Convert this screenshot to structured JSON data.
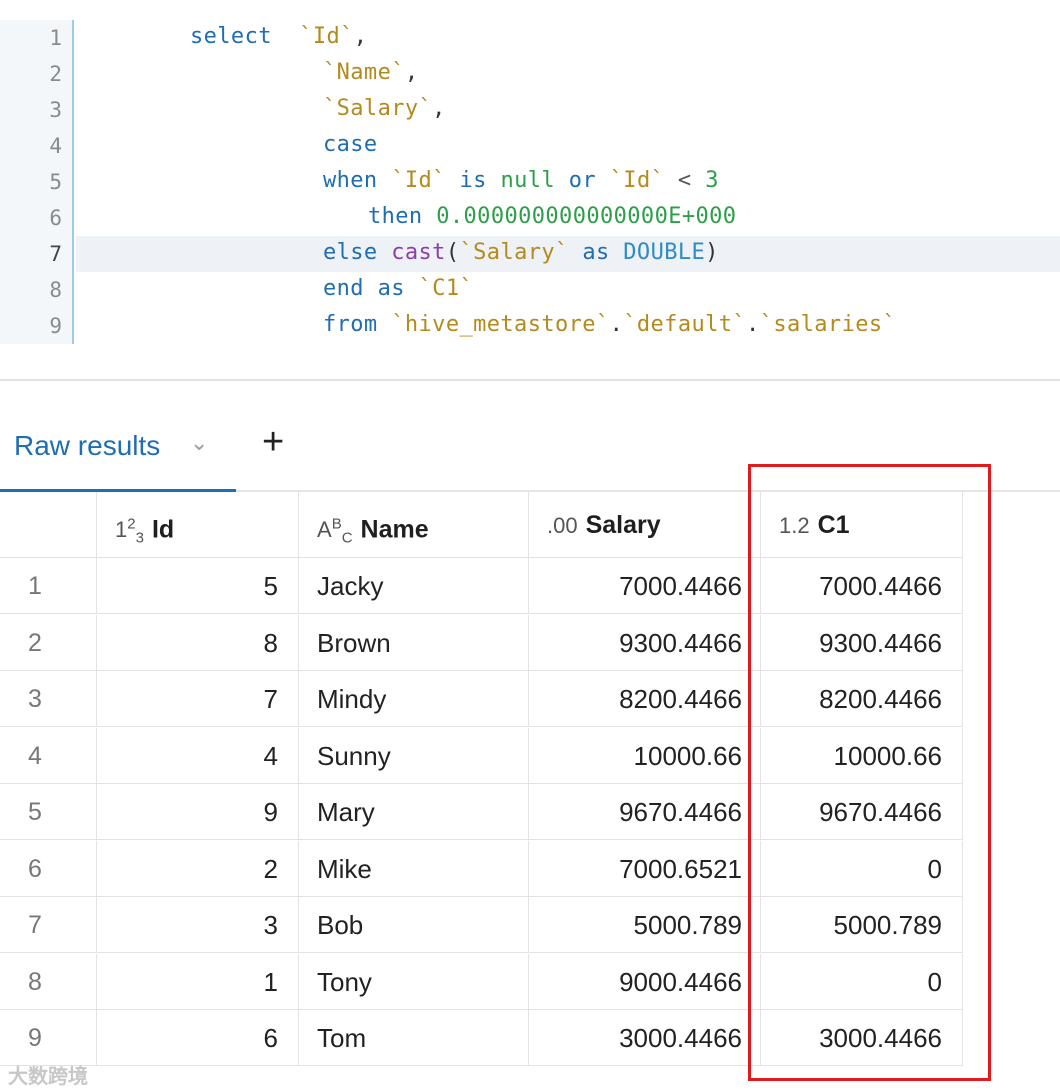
{
  "editor": {
    "line_numbers": [
      "1",
      "2",
      "3",
      "4",
      "5",
      "6",
      "7",
      "8",
      "9"
    ],
    "current_line": 7
  },
  "tabs": {
    "active_label": "Raw results",
    "add_label": "+"
  },
  "table": {
    "columns": [
      {
        "name": "",
        "type_icon": ""
      },
      {
        "name": "Id",
        "type_icon": "123-integer-icon"
      },
      {
        "name": "Name",
        "type_icon": "abc-string-icon"
      },
      {
        "name": "Salary",
        "type_icon": "decimal-00-icon"
      },
      {
        "name": "C1",
        "type_icon": "double-12-icon"
      }
    ],
    "rows": [
      [
        "1",
        "5",
        "Jacky",
        "7000.4466",
        "7000.4466"
      ],
      [
        "2",
        "8",
        "Brown",
        "9300.4466",
        "9300.4466"
      ],
      [
        "3",
        "7",
        "Mindy",
        "8200.4466",
        "8200.4466"
      ],
      [
        "4",
        "4",
        "Sunny",
        "10000.66",
        "10000.66"
      ],
      [
        "5",
        "9",
        "Mary",
        "9670.4466",
        "9670.4466"
      ],
      [
        "6",
        "2",
        "Mike",
        "7000.6521",
        "0"
      ],
      [
        "7",
        "3",
        "Bob",
        "5000.789",
        "5000.789"
      ],
      [
        "8",
        "1",
        "Tony",
        "9000.4466",
        "0"
      ],
      [
        "9",
        "6",
        "Tom",
        "3000.4466",
        "3000.4466"
      ]
    ]
  },
  "annotation": {
    "highlight_color": "#e01b1b"
  },
  "watermark": "大数跨境"
}
